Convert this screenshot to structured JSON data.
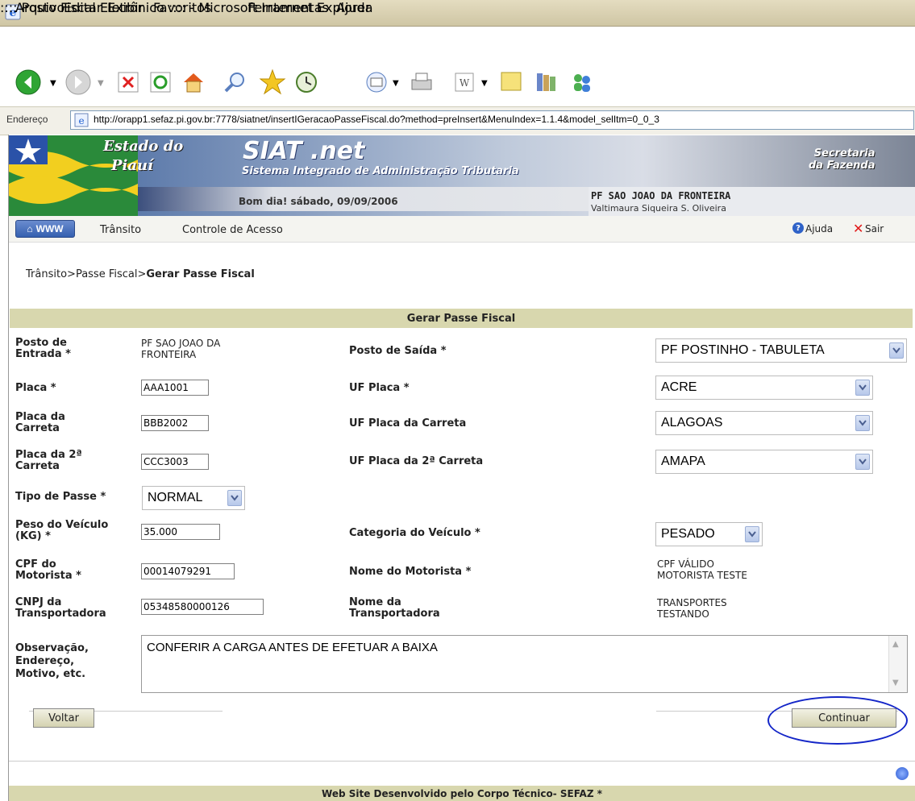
{
  "window": {
    "title": ":::: Posto Fiscal Eletrônico :::: - Microsoft Internet Explorer"
  },
  "menu": [
    "Arquivo",
    "Editar",
    "Exibir",
    "Favoritos",
    "Ferramentas",
    "Ajuda"
  ],
  "toolbar_icons": [
    "back-icon",
    "forward-icon",
    "stop-icon",
    "refresh-icon",
    "home-icon",
    "search-icon",
    "favorites-icon",
    "history-icon",
    "mail-icon",
    "print-icon",
    "word-icon",
    "notes-icon",
    "research-icon",
    "messenger-icon"
  ],
  "address": {
    "label": "Endereço",
    "url": "http://orapp1.sefaz.pi.gov.br:7778/siatnet/insertIGeracaoPasseFiscal.do?method=preInsert&MenuIndex=1.1.4&model_selItm=0_0_3"
  },
  "banner": {
    "estado_line1": "Estado do",
    "estado_line2": "Piauí",
    "siat_title": "SIAT .net",
    "siat_subtitle": "Sistema Integrado de Administração Tributaria",
    "secretaria_line1": "Secretaria",
    "secretaria_line2": "da Fazenda",
    "greeting": "Bom dia! sábado, 09/09/2006",
    "posto": "PF SAO JOAO DA FRONTEIRA",
    "user": "Valtimaura Siqueira S. Oliveira"
  },
  "nav": {
    "www": "WWW",
    "links": [
      "Trânsito",
      "Controle de Acesso"
    ],
    "ajuda": "Ajuda",
    "sair": "Sair"
  },
  "breadcrumb": {
    "part1": "Trânsito",
    "sep1": ">",
    "part2": "Passe Fiscal",
    "sep2": ">",
    "current": "Gerar Passe Fiscal"
  },
  "form": {
    "header": "Gerar Passe Fiscal",
    "posto_entrada_label1": "Posto de",
    "posto_entrada_label2": "Entrada *",
    "posto_entrada_value1": "PF SAO JOAO DA",
    "posto_entrada_value2": "FRONTEIRA",
    "posto_saida_label": "Posto de Saída *",
    "posto_saida_value": "PF POSTINHO - TABULETA",
    "placa_label": "Placa *",
    "placa_value": "AAA1001",
    "uf_placa_label": "UF Placa *",
    "uf_placa_value": "ACRE",
    "placa_carreta_label1": "Placa da",
    "placa_carreta_label2": "Carreta",
    "placa_carreta_value": "BBB2002",
    "uf_carreta_label": "UF Placa da Carreta",
    "uf_carreta_value": "ALAGOAS",
    "placa_2carreta_label1": "Placa da 2ª",
    "placa_2carreta_label2": "Carreta",
    "placa_2carreta_value": "CCC3003",
    "uf_2carreta_label": "UF Placa da 2ª Carreta",
    "uf_2carreta_value": "AMAPA",
    "tipo_passe_label": "Tipo de Passe *",
    "tipo_passe_value": "NORMAL",
    "peso_label1": "Peso do Veículo",
    "peso_label2": "(KG) *",
    "peso_value": "35.000",
    "categoria_label": "Categoria do Veículo *",
    "categoria_value": "PESADO",
    "cpf_label1": "CPF do",
    "cpf_label2": "Motorista *",
    "cpf_value": "00014079291",
    "nome_motorista_label": "Nome do Motorista *",
    "nome_motorista_value1": "CPF VÁLIDO",
    "nome_motorista_value2": "MOTORISTA TESTE",
    "cnpj_label1": "CNPJ da",
    "cnpj_label2": "Transportadora",
    "cnpj_value": "05348580000126",
    "nome_transp_label1": "Nome da",
    "nome_transp_label2": "Transportadora",
    "nome_transp_value1": "TRANSPORTES",
    "nome_transp_value2": "TESTANDO",
    "obs_label1": "Observação,",
    "obs_label2": "Endereço,",
    "obs_label3": "Motivo, etc.",
    "obs_value": "CONFERIR A CARGA ANTES DE EFETUAR A BAIXA",
    "voltar": "Voltar",
    "continuar": "Continuar"
  },
  "footer": "Web Site Desenvolvido pelo Corpo Técnico- SEFAZ *"
}
